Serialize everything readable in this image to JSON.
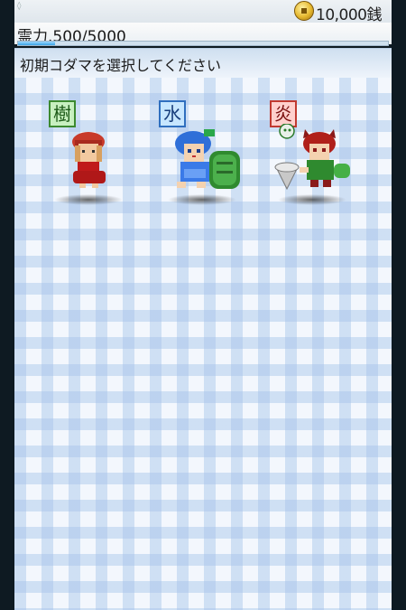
{
  "header": {
    "money": "10,000銭",
    "reiryoku": "霊力.500/5000",
    "reiryoku_ratio": 0.1
  },
  "title": "初期コダマを選択してください",
  "kodama": [
    {
      "element": "樹"
    },
    {
      "element": "水"
    },
    {
      "element": "炎"
    }
  ],
  "colors": {
    "wood": "#3c8a30",
    "water": "#2f6fbf",
    "fire": "#c03a30"
  }
}
